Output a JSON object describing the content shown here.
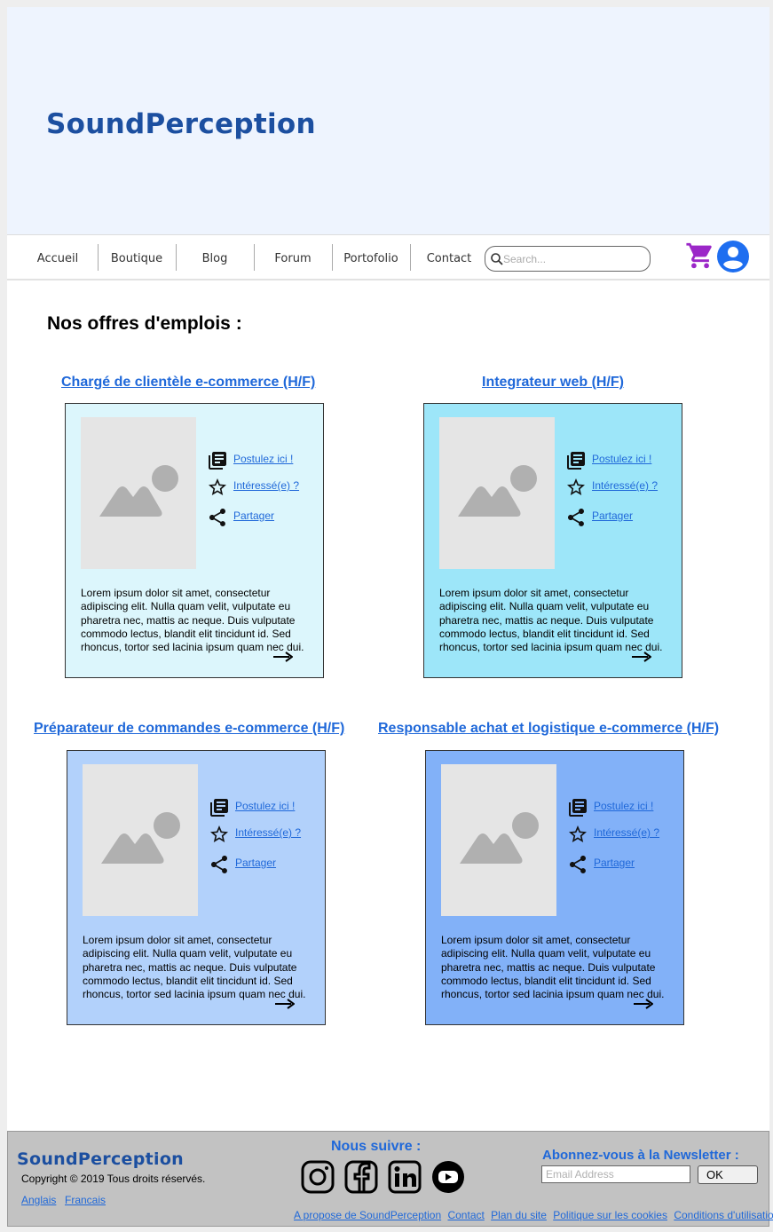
{
  "header": {
    "brand": "SoundPerception"
  },
  "nav": {
    "items": [
      "Accueil",
      "Boutique",
      "Blog",
      "Forum",
      "Portofolio",
      "Contact"
    ],
    "search_placeholder": "Search...",
    "cart_icon": "cart-icon",
    "user_icon": "user-icon",
    "accent_purple": "#9b27c8",
    "accent_blue": "#1e6ef0"
  },
  "main": {
    "title": "Nos offres d'emplois :",
    "jobs": [
      {
        "title": "Chargé de clientèle e-commerce (H/F)",
        "color": "#dcf6fc",
        "apply": "Postulez ici !",
        "interested": "Intéressé(e) ?",
        "share": "Partager",
        "description": "Lorem ipsum dolor sit amet, consectetur adipiscing elit. Nulla quam velit, vulputate eu pharetra nec, mattis ac neque. Duis vulputate commodo lectus, blandit elit tincidunt id. Sed rhoncus, tortor sed lacinia ipsum quam nec dui."
      },
      {
        "title": "Integrateur web (H/F)",
        "color": "#9de6f9",
        "apply": "Postulez ici !",
        "interested": "Intéressé(e) ?",
        "share": "Partager",
        "description": "Lorem ipsum dolor sit amet, consectetur adipiscing elit. Nulla quam velit, vulputate eu pharetra nec, mattis ac neque. Duis vulputate commodo lectus, blandit elit tincidunt id. Sed rhoncus, tortor sed lacinia ipsum quam nec dui."
      },
      {
        "title": "Préparateur de commandes e-commerce (H/F)",
        "color": "#b2d1fb",
        "apply": "Postulez ici !",
        "interested": "Intéressé(e) ?",
        "share": "Partager",
        "description": "Lorem ipsum dolor sit amet, consectetur adipiscing elit. Nulla quam velit, vulputate eu pharetra nec, mattis ac neque. Duis vulputate commodo lectus, blandit elit tincidunt id. Sed rhoncus, tortor sed lacinia ipsum quam nec dui."
      },
      {
        "title": "Responsable achat et logistique e-commerce (H/F)",
        "color": "#82b1f8",
        "apply": "Postulez ici !",
        "interested": "Intéressé(e) ?",
        "share": "Partager",
        "description": "Lorem ipsum dolor sit amet, consectetur adipiscing elit. Nulla quam velit, vulputate eu pharetra nec, mattis ac neque. Duis vulputate commodo lectus, blandit elit tincidunt id. Sed rhoncus, tortor sed lacinia ipsum quam nec dui."
      }
    ]
  },
  "footer": {
    "brand": "SoundPerception",
    "copyright": "Copyright © 2019 Tous droits réservés.",
    "lang_en": "Anglais",
    "lang_fr": "Francais",
    "follow": "Nous suivre :",
    "social": [
      "instagram-icon",
      "facebook-icon",
      "linkedin-icon",
      "youtube-icon"
    ],
    "newsletter": "Abonnez-vous à la Newsletter :",
    "email_placeholder": "Email Address",
    "ok": "OK",
    "links": [
      "A propose de SoundPerception",
      "Contact",
      "Plan du site",
      "Politique sur les cookies",
      "Conditions d'utilisation"
    ]
  }
}
